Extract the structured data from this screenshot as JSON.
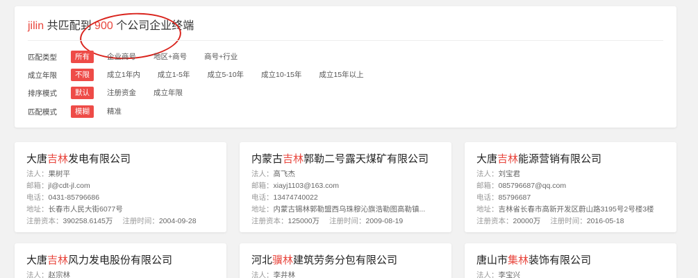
{
  "summary": {
    "keyword": "jilin",
    "prefix": "共匹配到",
    "count": "900",
    "suffix": "个公司企业终端"
  },
  "filters": [
    {
      "label": "匹配类型",
      "options": [
        "所有",
        "企业商号",
        "地区+商号",
        "商号+行业"
      ],
      "active": 0
    },
    {
      "label": "成立年限",
      "options": [
        "不限",
        "成立1年内",
        "成立1-5年",
        "成立5-10年",
        "成立10-15年",
        "成立15年以上"
      ],
      "active": 0
    },
    {
      "label": "排序模式",
      "options": [
        "默认",
        "注册资金",
        "成立年限"
      ],
      "active": 0
    },
    {
      "label": "匹配模式",
      "options": [
        "模糊",
        "精准"
      ],
      "active": 0
    }
  ],
  "labels": {
    "legal": "法人：",
    "email": "邮箱：",
    "phone": "电话：",
    "address": "地址：",
    "capital": "注册资本：",
    "reg_time": "注册时间："
  },
  "companies": [
    {
      "name_pre": "大唐",
      "name_kw": "吉林",
      "name_post": "发电有限公司",
      "legal": "果树平",
      "email": "jl@cdt-jl.com",
      "phone": "0431-85796686",
      "address": "长春市人民大街6077号",
      "capital": "390258.6145万",
      "reg_time": "2004-09-28"
    },
    {
      "name_pre": "内蒙古",
      "name_kw": "吉林",
      "name_post": "郭勒二号露天煤矿有限公司",
      "legal": "高飞杰",
      "email": "xiayj1103@163.com",
      "phone": "13474740022",
      "address": "内蒙古锡林郭勒盟西乌珠穆沁旗浩勒图高勒镇...",
      "capital": "125000万",
      "reg_time": "2009-08-19"
    },
    {
      "name_pre": "大唐",
      "name_kw": "吉林",
      "name_post": "能源营销有限公司",
      "legal": "刘宝君",
      "email": "085796687@qq.com",
      "phone": "85796687",
      "address": "吉林省长春市高新开发区蔚山路3195号2号楼3楼",
      "capital": "20000万",
      "reg_time": "2016-05-18"
    },
    {
      "name_pre": "大唐",
      "name_kw": "吉林",
      "name_post": "风力发电股份有限公司",
      "legal": "赵宗林"
    },
    {
      "name_pre": "河北",
      "name_kw": "骥林",
      "name_post": "建筑劳务分包有限公司",
      "legal": "李井林"
    },
    {
      "name_pre": "唐山市",
      "name_kw": "集林",
      "name_post": "装饰有限公司",
      "legal": "李宝兴"
    }
  ]
}
